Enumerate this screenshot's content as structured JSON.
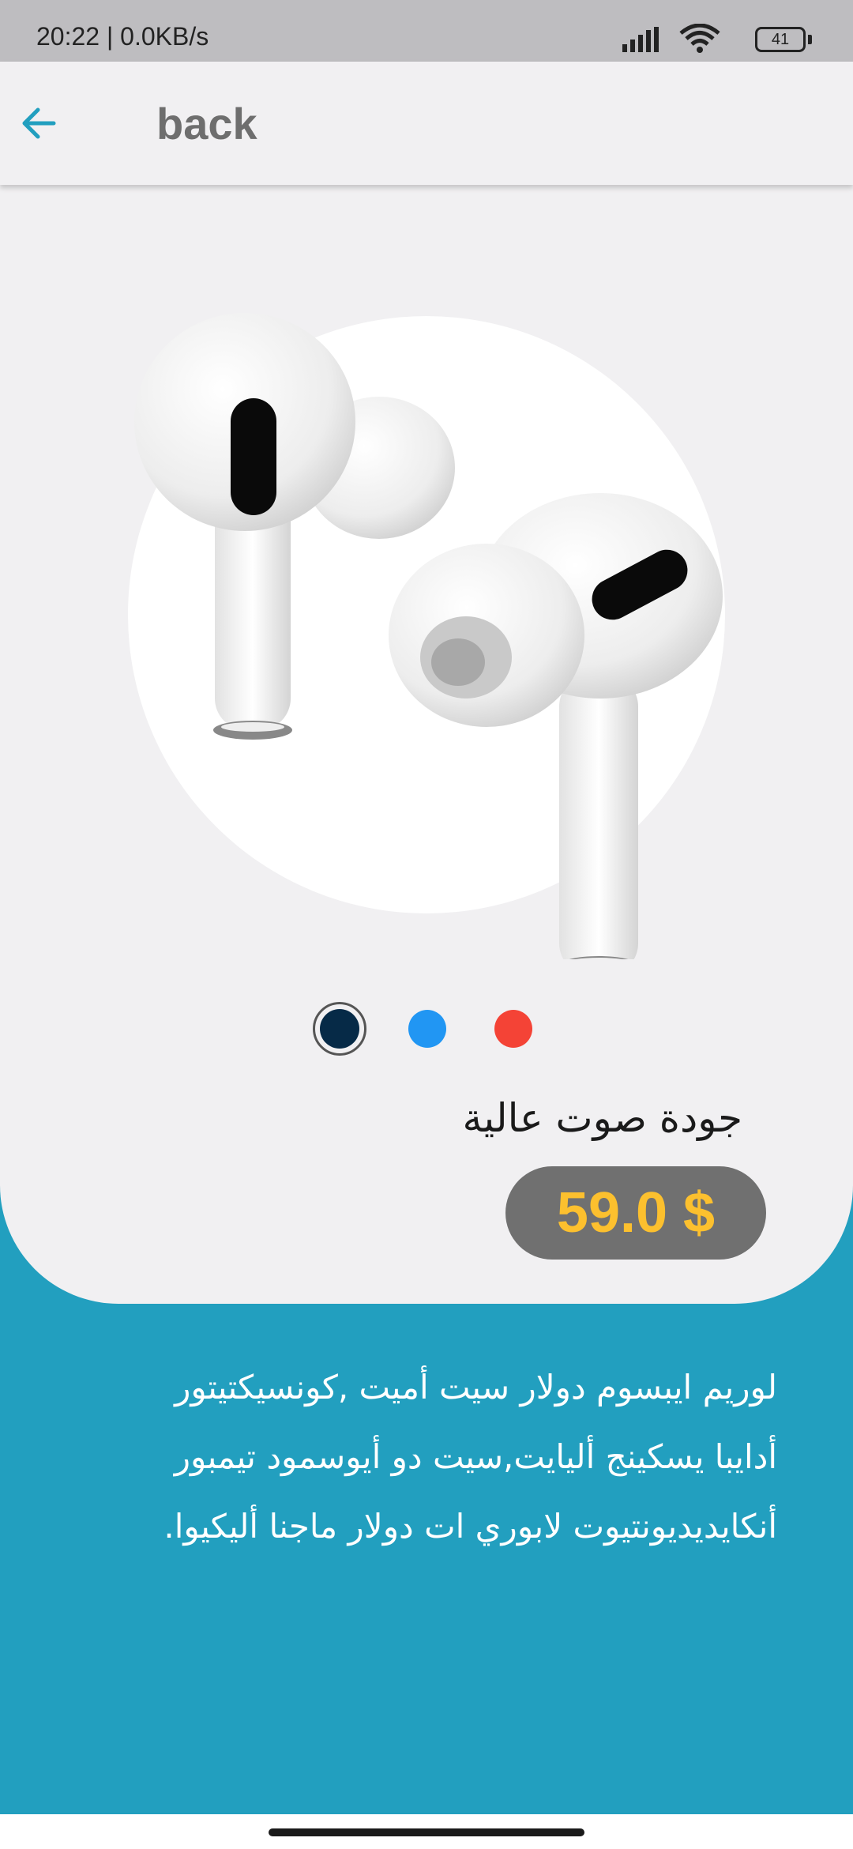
{
  "status_bar": {
    "time": "20:22 | 0.0KB/s",
    "battery": "41",
    "icons": [
      "signal-icon",
      "wifi-icon",
      "battery-icon"
    ]
  },
  "app_bar": {
    "back_icon": "arrow-left-icon",
    "back_label": "back",
    "accent_color": "#229FBF"
  },
  "product": {
    "image": "wireless-earbuds-image",
    "colors": [
      {
        "name": "dark-navy",
        "hex": "#062A47",
        "selected": true
      },
      {
        "name": "blue",
        "hex": "#2196F3",
        "selected": false
      },
      {
        "name": "red",
        "hex": "#F44336",
        "selected": false
      }
    ],
    "title": "جودة صوت عالية",
    "price": "59.0 $",
    "price_color": "#FCC02E",
    "description": [
      "لوريم ايبسوم دولار سيت أميت ,كونسيكتيتور",
      "أدايبا يسكينج أليايت,سيت دو أيوسمود تيمبور",
      "أنكايديديونتيوت لابوري ات دولار ماجنا أليكيوا."
    ]
  },
  "theme": {
    "background": "#229FBF",
    "card": "#F1F0F2",
    "price_badge": "#707070"
  }
}
